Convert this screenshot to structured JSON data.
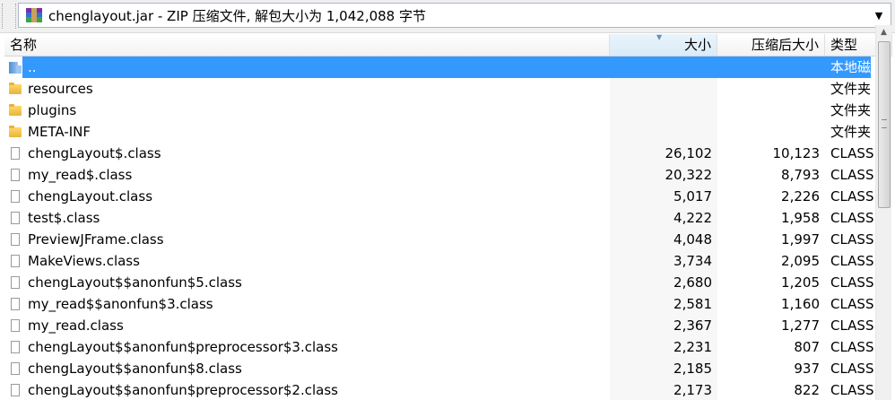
{
  "window": {
    "path_text": "chenglayout.jar - ZIP 压缩文件, 解包大小为 1,042,088 字节"
  },
  "columns": {
    "name": "名称",
    "size": "大小",
    "packed": "压缩后大小",
    "type": "类型"
  },
  "rows": [
    {
      "name": "..",
      "size": "",
      "packed": "",
      "type": "本地磁",
      "icon": "parent-folder-icon",
      "selected": true
    },
    {
      "name": "resources",
      "size": "",
      "packed": "",
      "type": "文件夹",
      "icon": "folder-icon"
    },
    {
      "name": "plugins",
      "size": "",
      "packed": "",
      "type": "文件夹",
      "icon": "folder-icon"
    },
    {
      "name": "META-INF",
      "size": "",
      "packed": "",
      "type": "文件夹",
      "icon": "folder-icon"
    },
    {
      "name": "chengLayout$.class",
      "size": "26,102",
      "packed": "10,123",
      "type": "CLASS",
      "icon": "file-icon"
    },
    {
      "name": "my_read$.class",
      "size": "20,322",
      "packed": "8,793",
      "type": "CLASS",
      "icon": "file-icon"
    },
    {
      "name": "chengLayout.class",
      "size": "5,017",
      "packed": "2,226",
      "type": "CLASS",
      "icon": "file-icon"
    },
    {
      "name": "test$.class",
      "size": "4,222",
      "packed": "1,958",
      "type": "CLASS",
      "icon": "file-icon"
    },
    {
      "name": "PreviewJFrame.class",
      "size": "4,048",
      "packed": "1,997",
      "type": "CLASS",
      "icon": "file-icon"
    },
    {
      "name": "MakeViews.class",
      "size": "3,734",
      "packed": "2,095",
      "type": "CLASS",
      "icon": "file-icon"
    },
    {
      "name": "chengLayout$$anonfun$5.class",
      "size": "2,680",
      "packed": "1,205",
      "type": "CLASS",
      "icon": "file-icon"
    },
    {
      "name": "my_read$$anonfun$3.class",
      "size": "2,581",
      "packed": "1,160",
      "type": "CLASS",
      "icon": "file-icon"
    },
    {
      "name": "my_read.class",
      "size": "2,367",
      "packed": "1,277",
      "type": "CLASS",
      "icon": "file-icon"
    },
    {
      "name": "chengLayout$$anonfun$preprocessor$3.class",
      "size": "2,231",
      "packed": "807",
      "type": "CLASS",
      "icon": "file-icon"
    },
    {
      "name": "chengLayout$$anonfun$8.class",
      "size": "2,185",
      "packed": "937",
      "type": "CLASS",
      "icon": "file-icon"
    },
    {
      "name": "chengLayout$$anonfun$preprocessor$2.class",
      "size": "2,173",
      "packed": "822",
      "type": "CLASS",
      "icon": "file-icon"
    }
  ],
  "colors": {
    "selection": "#3399ff",
    "sorted_column": "#d9ebf7"
  }
}
